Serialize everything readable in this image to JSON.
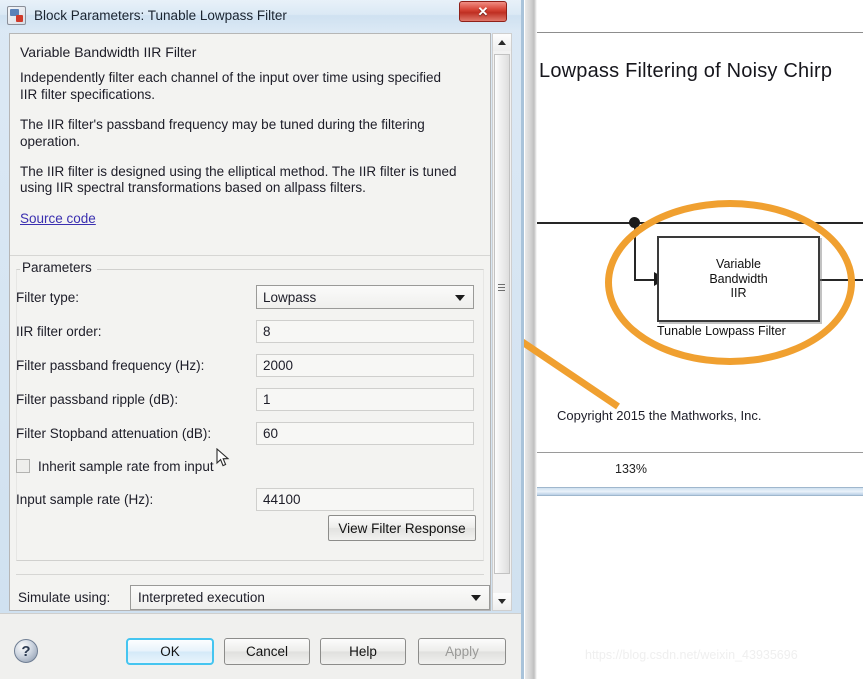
{
  "dialog": {
    "title": "Block Parameters: Tunable Lowpass Filter",
    "icon": "simulink-block-icon",
    "close_label": "✕",
    "description": {
      "heading": "Variable Bandwidth IIR Filter",
      "paragraphs": [
        "Independently filter each channel of the input over time using specified IIR filter specifications.",
        "The IIR filter's passband frequency may be tuned during the filtering operation.",
        "The IIR filter is designed using the elliptical method. The IIR filter is tuned using IIR spectral transformations based on allpass filters."
      ],
      "source_link": "Source code"
    },
    "parameters": {
      "legend": "Parameters",
      "rows": [
        {
          "label": "Filter type:",
          "value": "Lowpass",
          "type": "combo"
        },
        {
          "label": "IIR filter order:",
          "value": "8",
          "type": "text"
        },
        {
          "label": "Filter passband frequency (Hz):",
          "value": "2000",
          "type": "text"
        },
        {
          "label": "Filter passband ripple (dB):",
          "value": "1",
          "type": "text"
        },
        {
          "label": "Filter Stopband attenuation (dB):",
          "value": "60",
          "type": "text"
        }
      ],
      "checkbox": {
        "label": "Inherit sample rate from input",
        "checked": false
      },
      "sample_rate": {
        "label": "Input sample rate (Hz):",
        "value": "44100"
      },
      "view_response_button": "View Filter Response"
    },
    "simulate": {
      "label": "Simulate using:",
      "value": "Interpreted execution"
    },
    "buttons": {
      "help_glyph": "?",
      "ok": "OK",
      "cancel": "Cancel",
      "help": "Help",
      "apply": "Apply"
    }
  },
  "model": {
    "title": "Lowpass Filtering of Noisy Chirp",
    "block_label": "Variable\nBandwidth\nIIR",
    "block_caption": "Tunable Lowpass Filter",
    "copyright": "Copyright 2015 the Mathworks, Inc.",
    "zoom": "133%",
    "highlight_color": "#f0a030"
  },
  "watermark": "https://blog.csdn.net/weixin_43935696"
}
